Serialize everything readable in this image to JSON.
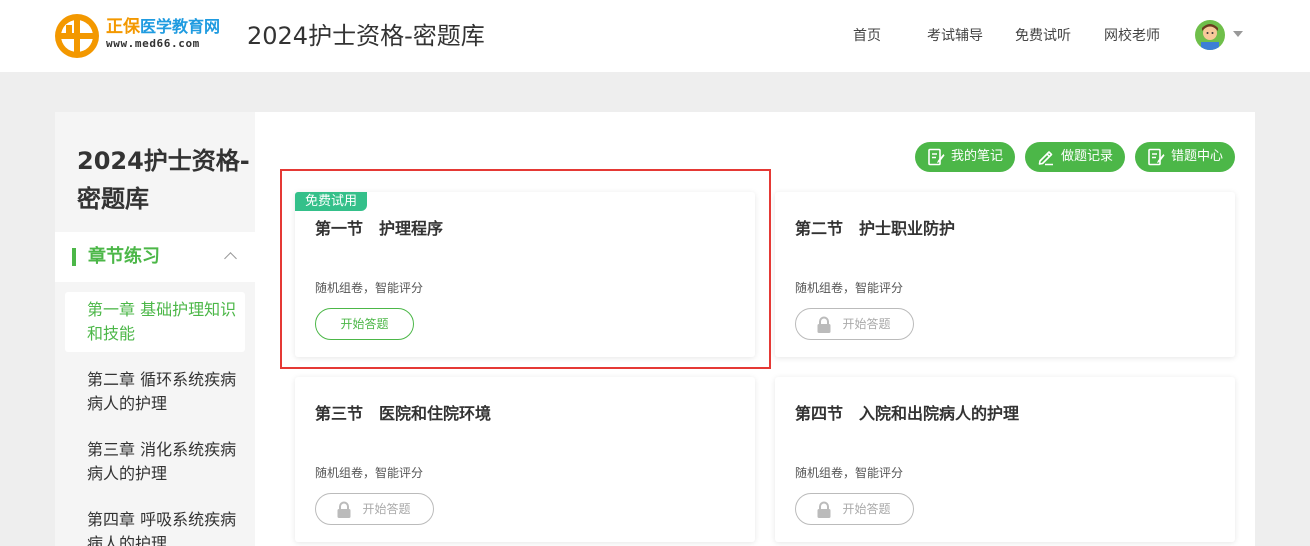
{
  "header": {
    "brand_zb": "正保",
    "brand_rest": "医学教育网",
    "brand_url": "www.med66.com",
    "site_title": "2024护士资格-密题库",
    "nav": [
      "首页",
      "考试辅导",
      "免费试听",
      "网校老师"
    ]
  },
  "sidebar": {
    "title": "2024护士资格-密题库",
    "section_label": "章节练习",
    "items": [
      {
        "label": "第一章 基础护理知识和技能",
        "active": true
      },
      {
        "label": "第二章 循环系统疾病病人的护理",
        "active": false
      },
      {
        "label": "第三章 消化系统疾病病人的护理",
        "active": false
      },
      {
        "label": "第四章 呼吸系统疾病病人的护理",
        "active": false
      }
    ]
  },
  "tools": {
    "notes_label": "我的笔记",
    "history_label": "做题记录",
    "wrong_label": "错题中心"
  },
  "cards": [
    {
      "badge": "免费试用",
      "title": "第一节　护理程序",
      "desc": "随机组卷，智能评分",
      "button": "开始答题",
      "locked": false
    },
    {
      "badge": "",
      "title": "第二节　护士职业防护",
      "desc": "随机组卷，智能评分",
      "button": "开始答题",
      "locked": true
    },
    {
      "badge": "",
      "title": "第三节　医院和住院环境",
      "desc": "随机组卷，智能评分",
      "button": "开始答题",
      "locked": true
    },
    {
      "badge": "",
      "title": "第四节　入院和出院病人的护理",
      "desc": "随机组卷，智能评分",
      "button": "开始答题",
      "locked": true
    }
  ],
  "colors": {
    "accent": "#4cb748",
    "badge": "#34c08a",
    "highlight": "#e53935",
    "brand_blue": "#1f9be0",
    "brand_orange": "#f39800"
  }
}
